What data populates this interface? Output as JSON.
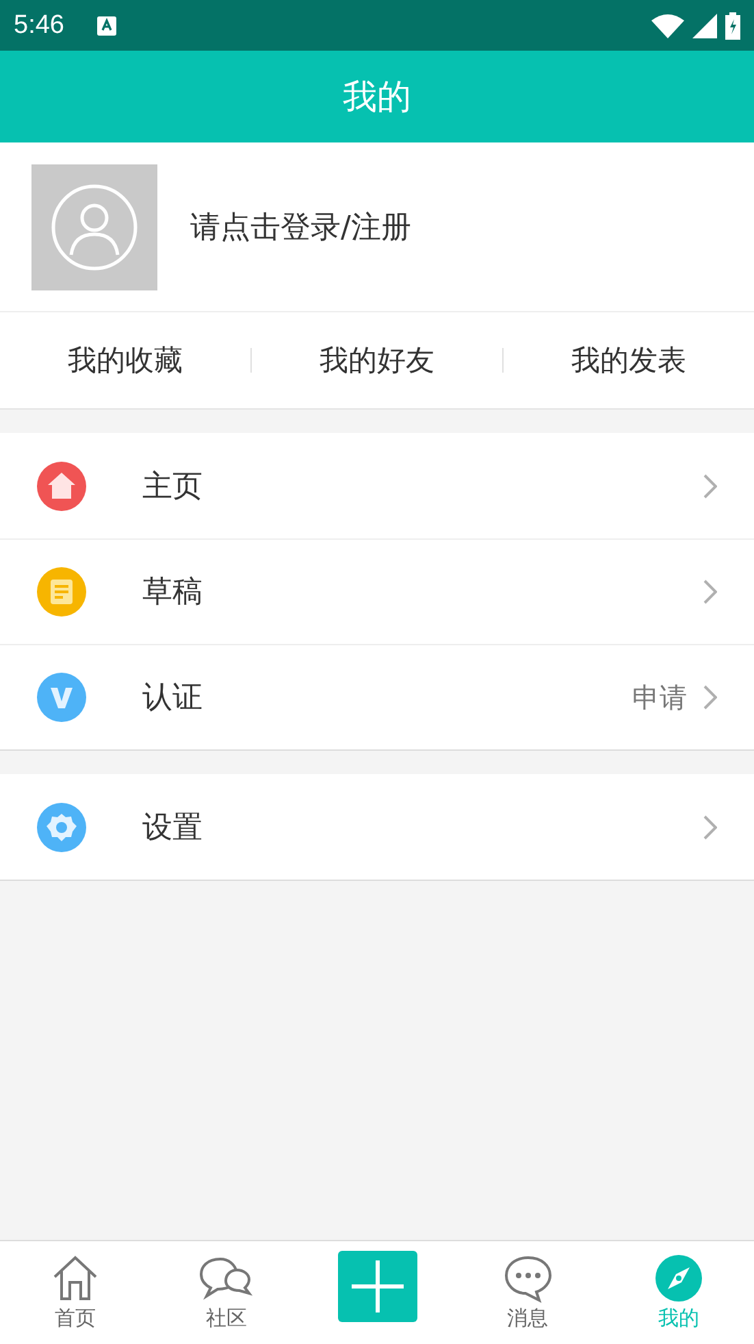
{
  "status_bar": {
    "time": "5:46"
  },
  "header": {
    "title": "我的"
  },
  "profile": {
    "login_text": "请点击登录/注册"
  },
  "shortcuts": [
    "我的收藏",
    "我的好友",
    "我的发表"
  ],
  "menu_groups": [
    [
      {
        "kind": "home",
        "label": "主页"
      },
      {
        "kind": "draft",
        "label": "草稿"
      },
      {
        "kind": "verify",
        "label": "认证",
        "detail": "申请"
      }
    ],
    [
      {
        "kind": "settings",
        "label": "设置"
      }
    ]
  ],
  "bottom_nav": [
    {
      "kind": "home",
      "label": "首页",
      "selected": false
    },
    {
      "kind": "community",
      "label": "社区",
      "selected": false
    },
    {
      "kind": "add"
    },
    {
      "kind": "messages",
      "label": "消息",
      "selected": false
    },
    {
      "kind": "mine",
      "label": "我的",
      "selected": true
    }
  ]
}
